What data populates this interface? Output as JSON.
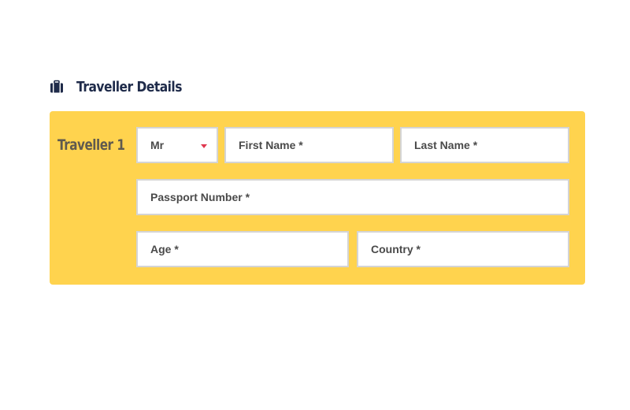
{
  "section": {
    "title": "Traveller Details",
    "icon": "suitcase-icon"
  },
  "traveller": {
    "label": "Traveller 1",
    "title_select": {
      "selected": "Mr"
    },
    "first_name": {
      "placeholder": "First Name *"
    },
    "last_name": {
      "placeholder": "Last Name *"
    },
    "passport": {
      "placeholder": "Passport Number *"
    },
    "age": {
      "placeholder": "Age *"
    },
    "country": {
      "placeholder": "Country *"
    }
  },
  "colors": {
    "panel": "#ffd34e",
    "heading": "#1f2b4a",
    "caret": "#e0384f"
  }
}
